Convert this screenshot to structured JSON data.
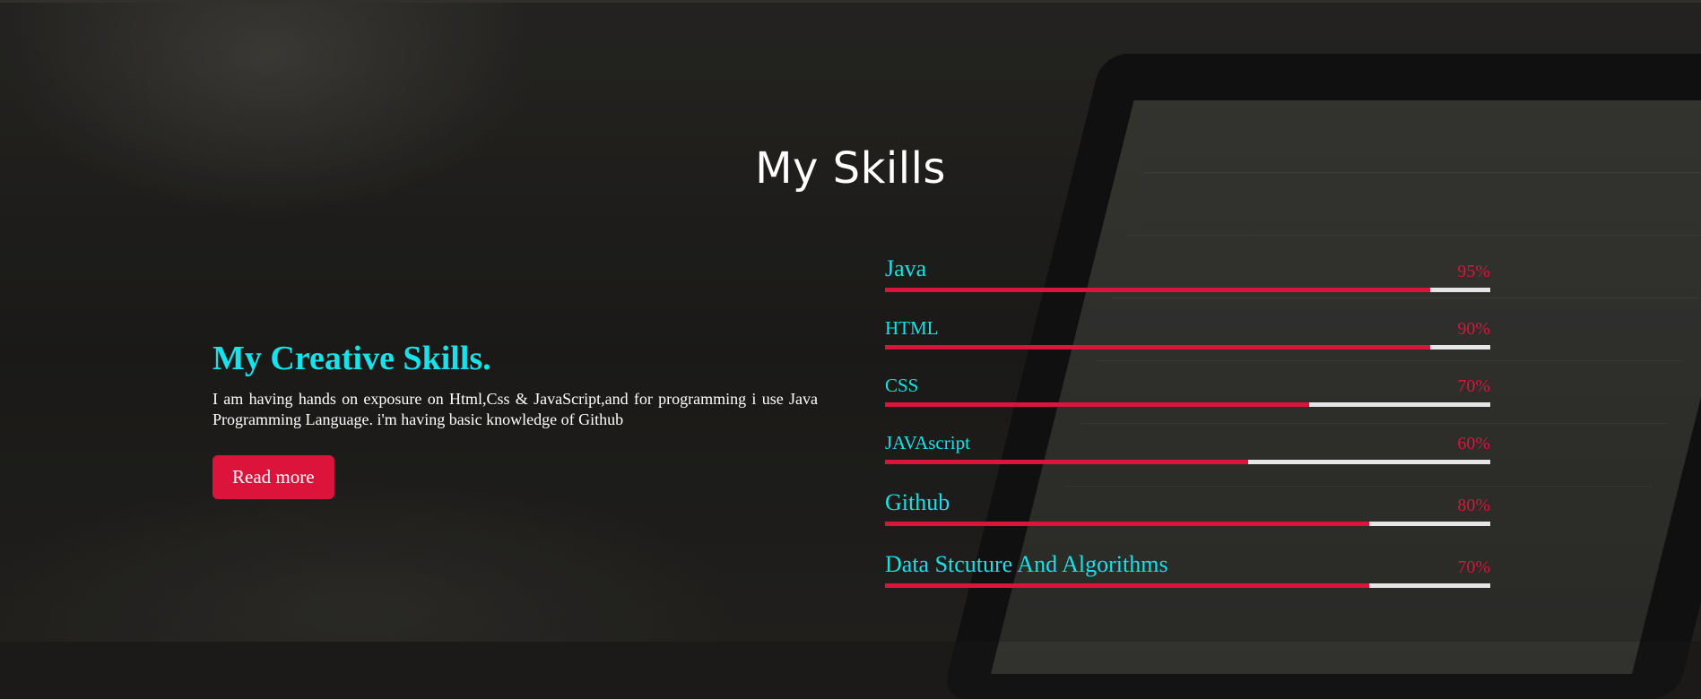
{
  "section": {
    "title": "My Skills"
  },
  "intro": {
    "heading": "My Creative Skills.",
    "text": "I am having hands on exposure on Html,Css & JavaScript,and for programming i use Java Programming Language. i'm having basic knowledge of Github",
    "button_label": "Read more"
  },
  "skills": [
    {
      "name": "Java",
      "percent_label": "95%",
      "level": 0.9
    },
    {
      "name": "HTML",
      "percent_label": "90%",
      "level": 0.9
    },
    {
      "name": "CSS",
      "percent_label": "70%",
      "level": 0.7
    },
    {
      "name": "JAVAscript",
      "percent_label": "60%",
      "level": 0.6
    },
    {
      "name": "Github",
      "percent_label": "80%",
      "level": 0.8
    },
    {
      "name": "Data Stcuture And Algorithms",
      "percent_label": "70%",
      "level": 0.8
    }
  ],
  "colors": {
    "accent": "#dc143c",
    "heading_cyan": "#17e2ea",
    "track": "#e6e6e6",
    "text": "#ffffff"
  }
}
